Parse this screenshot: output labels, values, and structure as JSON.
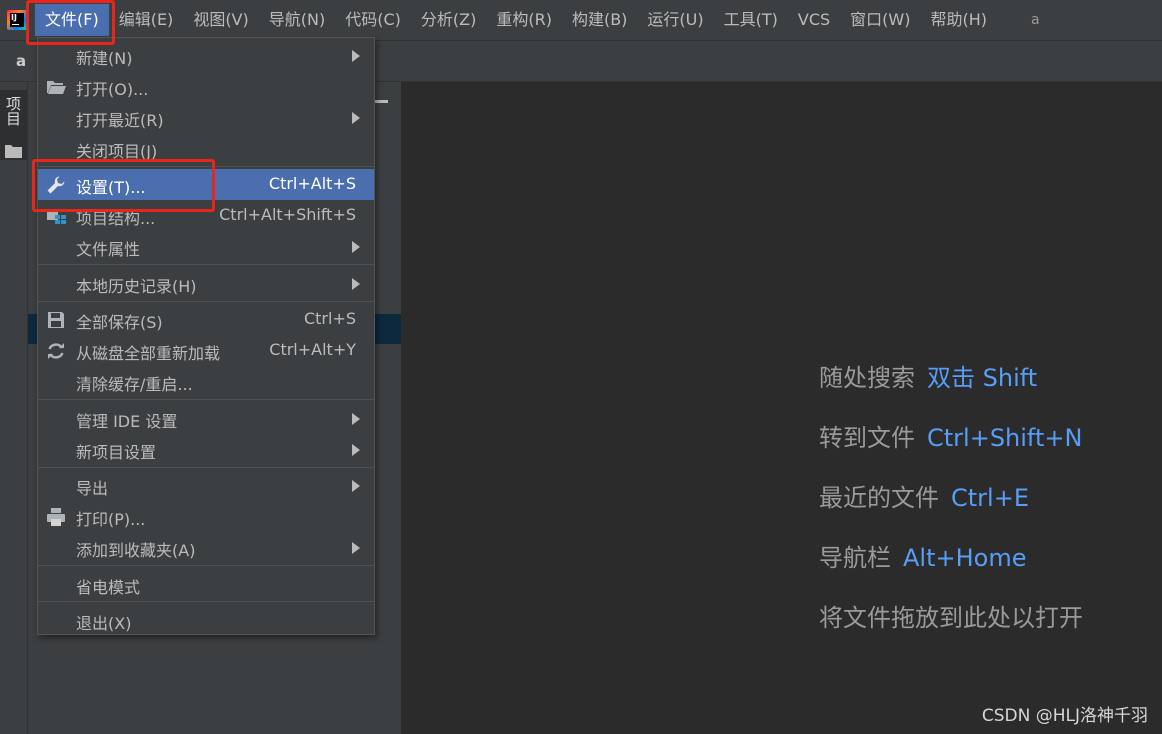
{
  "menubar": {
    "items": [
      {
        "label": "文件(F)"
      },
      {
        "label": "编辑(E)"
      },
      {
        "label": "视图(V)"
      },
      {
        "label": "导航(N)"
      },
      {
        "label": "代码(C)"
      },
      {
        "label": "分析(Z)"
      },
      {
        "label": "重构(R)"
      },
      {
        "label": "构建(B)"
      },
      {
        "label": "运行(U)"
      },
      {
        "label": "工具(T)"
      },
      {
        "label": "VCS"
      },
      {
        "label": "窗口(W)"
      },
      {
        "label": "帮助(H)"
      }
    ],
    "window_title": "a"
  },
  "navbar": {
    "crumb": "a"
  },
  "sidebar": {
    "project_tab": "项目"
  },
  "file_menu": {
    "items": [
      {
        "label": "新建(N)",
        "submenu": true
      },
      {
        "label": "打开(O)...",
        "icon": "folder-open-icon"
      },
      {
        "label": "打开最近(R)",
        "submenu": true
      },
      {
        "label": "关闭项目(J)"
      },
      {
        "label": "设置(T)...",
        "shortcut": "Ctrl+Alt+S",
        "icon": "wrench-icon",
        "highlighted": true
      },
      {
        "label": "项目结构...",
        "shortcut": "Ctrl+Alt+Shift+S",
        "icon": "project-structure-icon"
      },
      {
        "label": "文件属性",
        "submenu": true
      },
      {
        "label": "本地历史记录(H)",
        "submenu": true
      },
      {
        "label": "全部保存(S)",
        "shortcut": "Ctrl+S",
        "icon": "save-icon"
      },
      {
        "label": "从磁盘全部重新加载",
        "shortcut": "Ctrl+Alt+Y",
        "icon": "reload-icon"
      },
      {
        "label": "清除缓存/重启..."
      },
      {
        "label": "管理 IDE 设置",
        "submenu": true
      },
      {
        "label": "新项目设置",
        "submenu": true
      },
      {
        "label": "导出",
        "submenu": true
      },
      {
        "label": "打印(P)...",
        "icon": "printer-icon"
      },
      {
        "label": "添加到收藏夹(A)",
        "submenu": true
      },
      {
        "label": "省电模式"
      },
      {
        "label": "退出(X)"
      }
    ]
  },
  "welcome": {
    "hints": [
      {
        "label": "随处搜索",
        "key": "双击 Shift"
      },
      {
        "label": "转到文件",
        "key": "Ctrl+Shift+N"
      },
      {
        "label": "最近的文件",
        "key": "Ctrl+E"
      },
      {
        "label": "导航栏",
        "key": "Alt+Home"
      },
      {
        "label": "将文件拖放到此处以打开",
        "key": ""
      }
    ]
  },
  "watermark": "CSDN @HLJ洛神千羽",
  "colors": {
    "accent": "#4b6eaf",
    "shortcut_blue": "#589df6",
    "annotation_red": "#e8261c"
  }
}
